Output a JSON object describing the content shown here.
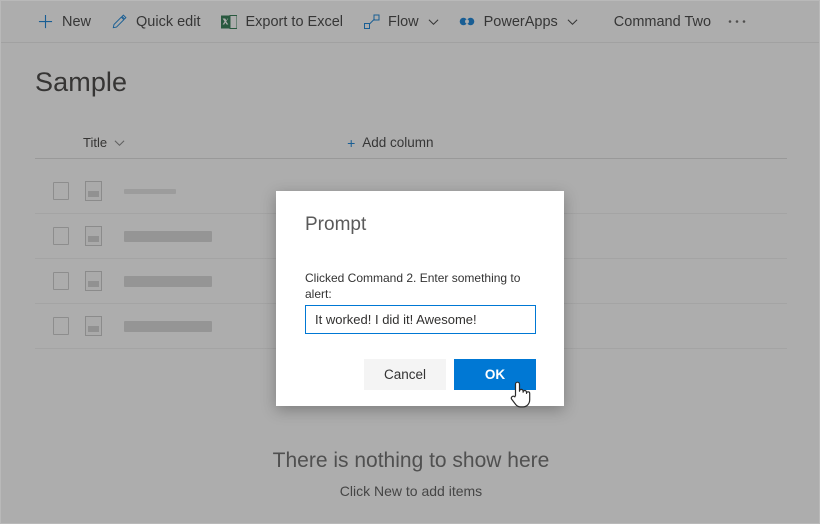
{
  "commandbar": {
    "items": [
      {
        "label": "New",
        "icon": "plus-icon",
        "has_caret": false
      },
      {
        "label": "Quick edit",
        "icon": "pencil-icon",
        "has_caret": false
      },
      {
        "label": "Export to Excel",
        "icon": "excel-icon",
        "has_caret": false
      },
      {
        "label": "Flow",
        "icon": "flow-icon",
        "has_caret": true
      },
      {
        "label": "PowerApps",
        "icon": "powerapps-icon",
        "has_caret": true
      },
      {
        "label": "Command Two",
        "icon": "none",
        "has_caret": false
      }
    ],
    "overflow_label": "• • •",
    "accent_color": "#0078d4"
  },
  "page": {
    "title": "Sample",
    "column_header": "Title",
    "add_column_label": "Add column",
    "add_column_plus": "+",
    "empty_state_title": "There is nothing to show here",
    "empty_state_subtitle": "Click New to add items"
  },
  "dialog": {
    "title": "Prompt",
    "subtext": "Clicked Command 2. Enter something to alert:",
    "input_value": "It worked! I did it! Awesome!",
    "input_placeholder": "",
    "cancel_label": "Cancel",
    "ok_label": "OK",
    "primary_color": "#0078d4",
    "secondary_color": "#f4f4f4"
  },
  "cursor": {
    "type": "pointing-hand"
  }
}
